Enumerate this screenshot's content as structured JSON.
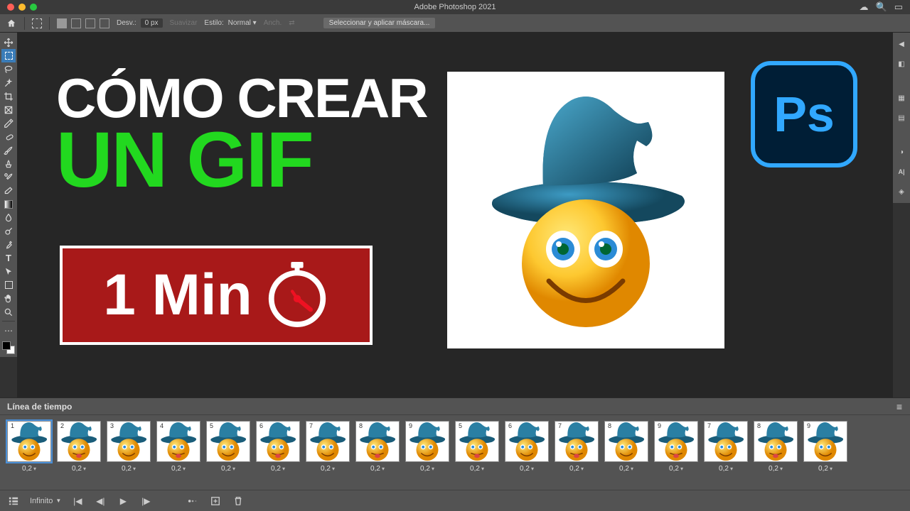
{
  "app": {
    "title": "Adobe Photoshop 2021"
  },
  "optionsbar": {
    "desv_label": "Desv.:",
    "desv_value": "0 px",
    "suavizar": "Suavizar",
    "estilo_label": "Estilo:",
    "estilo_value": "Normal",
    "anch": "Anch.",
    "select_mask": "Seleccionar y aplicar máscara..."
  },
  "overlay": {
    "line1": "CÓMO CREAR",
    "line2": "UN GIF",
    "badge_text": "1 Min"
  },
  "ps_logo_text": "Ps",
  "timeline": {
    "title": "Línea de tiempo",
    "loop_label": "Infinito",
    "frames": [
      {
        "n": "1",
        "delay": "0,2",
        "sel": true
      },
      {
        "n": "2",
        "delay": "0,2",
        "sel": false
      },
      {
        "n": "3",
        "delay": "0,2",
        "sel": false
      },
      {
        "n": "4",
        "delay": "0,2",
        "sel": false
      },
      {
        "n": "5",
        "delay": "0,2",
        "sel": false
      },
      {
        "n": "6",
        "delay": "0,2",
        "sel": false
      },
      {
        "n": "7",
        "delay": "0,2",
        "sel": false
      },
      {
        "n": "8",
        "delay": "0,2",
        "sel": false
      },
      {
        "n": "9",
        "delay": "0,2",
        "sel": false
      },
      {
        "n": "5",
        "delay": "0,2",
        "sel": false
      },
      {
        "n": "6",
        "delay": "0,2",
        "sel": false
      },
      {
        "n": "7",
        "delay": "0,2",
        "sel": false
      },
      {
        "n": "8",
        "delay": "0,2",
        "sel": false
      },
      {
        "n": "9",
        "delay": "0,2",
        "sel": false
      },
      {
        "n": "7",
        "delay": "0,2",
        "sel": false
      },
      {
        "n": "8",
        "delay": "0,2",
        "sel": false
      },
      {
        "n": "9",
        "delay": "0,2",
        "sel": false
      }
    ]
  },
  "tools": [
    "move",
    "marquee",
    "lasso",
    "magic-wand",
    "crop",
    "frame",
    "eyedropper",
    "healing",
    "brush",
    "clone",
    "history-brush",
    "eraser",
    "gradient",
    "blur",
    "dodge",
    "pen",
    "type",
    "path-select",
    "rectangle",
    "hand",
    "zoom",
    "edit-toolbar"
  ],
  "right_panels": [
    "expand",
    "color",
    "swatches",
    "adjustments",
    "character",
    "layers",
    "3d"
  ]
}
